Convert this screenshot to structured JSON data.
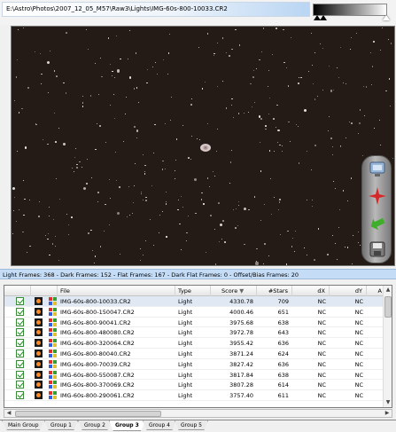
{
  "path": "E:\\Astro\\Photos\\2007_12_05_M57\\Raw3\\Lights\\IMG-60s-800-10033.CR2",
  "status": {
    "light": "Light Frames: 368",
    "sep1": " - ",
    "dark": "Dark Frames: 152",
    "sep2": " - ",
    "flat": "Flat Frames: 167",
    "sep3": " - ",
    "darkflat": "Dark Flat Frames: 0",
    "sep4": " - ",
    "offset": "Offset/Bias Frames: 20"
  },
  "tools": {
    "icons": [
      "monitor-icon",
      "star-crosshair-icon",
      "green-arrow-icon",
      "save-icon"
    ]
  },
  "columns": {
    "file": "File",
    "type": "Type",
    "score": "Score",
    "stars": "#Stars",
    "dx": "dX",
    "dy": "dY",
    "more": "A"
  },
  "rows": [
    {
      "file": "IMG-60s-800-10033.CR2",
      "type": "Light",
      "score": "4330.78",
      "stars": "709",
      "dx": "NC",
      "dy": "NC"
    },
    {
      "file": "IMG-60s-800-150047.CR2",
      "type": "Light",
      "score": "4000.46",
      "stars": "651",
      "dx": "NC",
      "dy": "NC"
    },
    {
      "file": "IMG-60s-800-90041.CR2",
      "type": "Light",
      "score": "3975.68",
      "stars": "638",
      "dx": "NC",
      "dy": "NC"
    },
    {
      "file": "IMG-60s-800-480080.CR2",
      "type": "Light",
      "score": "3972.78",
      "stars": "643",
      "dx": "NC",
      "dy": "NC"
    },
    {
      "file": "IMG-60s-800-320064.CR2",
      "type": "Light",
      "score": "3955.42",
      "stars": "636",
      "dx": "NC",
      "dy": "NC"
    },
    {
      "file": "IMG-60s-800-80040.CR2",
      "type": "Light",
      "score": "3871.24",
      "stars": "624",
      "dx": "NC",
      "dy": "NC"
    },
    {
      "file": "IMG-60s-800-70039.CR2",
      "type": "Light",
      "score": "3827.42",
      "stars": "636",
      "dx": "NC",
      "dy": "NC"
    },
    {
      "file": "IMG-60s-800-550087.CR2",
      "type": "Light",
      "score": "3817.84",
      "stars": "638",
      "dx": "NC",
      "dy": "NC"
    },
    {
      "file": "IMG-60s-800-370069.CR2",
      "type": "Light",
      "score": "3807.28",
      "stars": "614",
      "dx": "NC",
      "dy": "NC"
    },
    {
      "file": "IMG-60s-800-290061.CR2",
      "type": "Light",
      "score": "3757.40",
      "stars": "611",
      "dx": "NC",
      "dy": "NC"
    }
  ],
  "tabs": [
    "Main Group",
    "Group 1",
    "Group 2",
    "Group 3",
    "Group 4",
    "Group 5"
  ],
  "active_tab": "Group 3",
  "colors": {
    "viewer_bg": "#241b17",
    "status_bg": "#c4dcf5",
    "check_green": "#1c8a1c"
  }
}
